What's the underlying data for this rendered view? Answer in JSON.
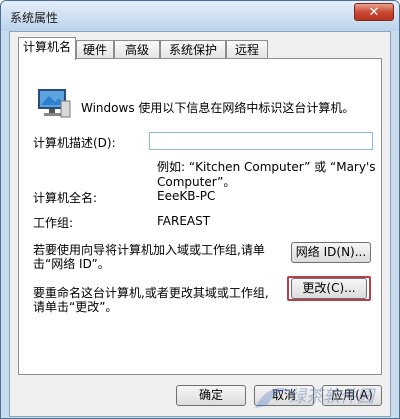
{
  "window": {
    "title": "系统属性",
    "close_label": "✕"
  },
  "tabs": [
    {
      "label": "计算机名",
      "active": true
    },
    {
      "label": "硬件",
      "active": false
    },
    {
      "label": "高级",
      "active": false
    },
    {
      "label": "系统保护",
      "active": false
    },
    {
      "label": "远程",
      "active": false
    }
  ],
  "panel": {
    "intro": "Windows 使用以下信息在网络中标识这台计算机。",
    "description_label": "计算机描述(D):",
    "description_value": "",
    "example_line1": "例如: “Kitchen Computer” 或 “Mary's",
    "example_line2": "Computer”。",
    "full_name_label": "计算机全名:",
    "full_name_value": "EeeKB-PC",
    "workgroup_label": "工作组:",
    "workgroup_value": "FAREAST",
    "wizard_text_line1": "若要使用向导将计算机加入域或工作组,请单",
    "wizard_text_line2": "击“网络 ID”。",
    "network_id_button": "网络 ID(N)...",
    "rename_text_line1": "要重命名这台计算机,或者更改其域或工作组,",
    "rename_text_line2": "请单击“更改”。",
    "change_button": "更改(C)..."
  },
  "footer": {
    "ok_button": "确定",
    "cancel_button": "取消",
    "apply_button": "应用(A)"
  },
  "watermark": {
    "text": "绿茶软件园"
  },
  "icons": {
    "computer": "computer-icon",
    "close": "close-icon"
  }
}
